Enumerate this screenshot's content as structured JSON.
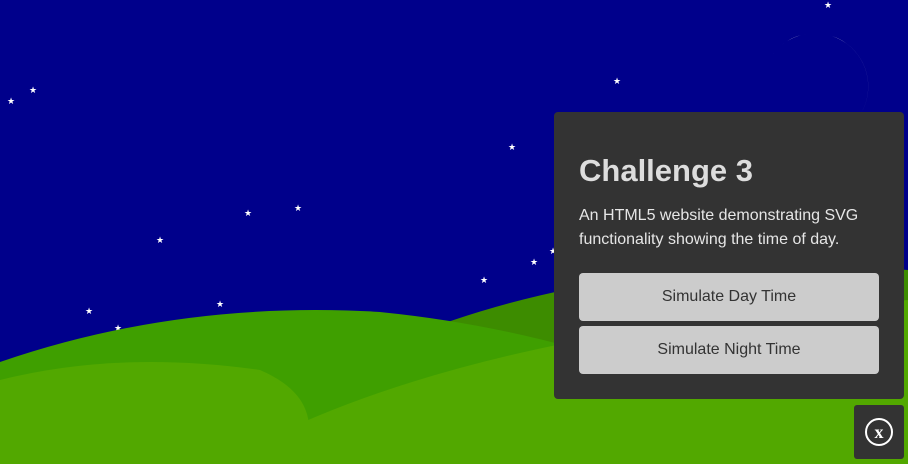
{
  "panel": {
    "title": "Challenge 3",
    "description": "An HTML5 website demonstrating SVG functionality showing the time of day.",
    "day_button_label": "Simulate Day Time",
    "night_button_label": "Simulate Night Time"
  },
  "close_button": {
    "icon": "close-icon",
    "glyph": "x"
  },
  "scene": {
    "mode": "night",
    "sky_color": "#00008b",
    "moon_color": "#ffffee",
    "hill_colors": [
      "#3d8c00",
      "#3f9f00",
      "#52a800"
    ],
    "panel_color": "#333333",
    "button_color": "#cccccc"
  }
}
